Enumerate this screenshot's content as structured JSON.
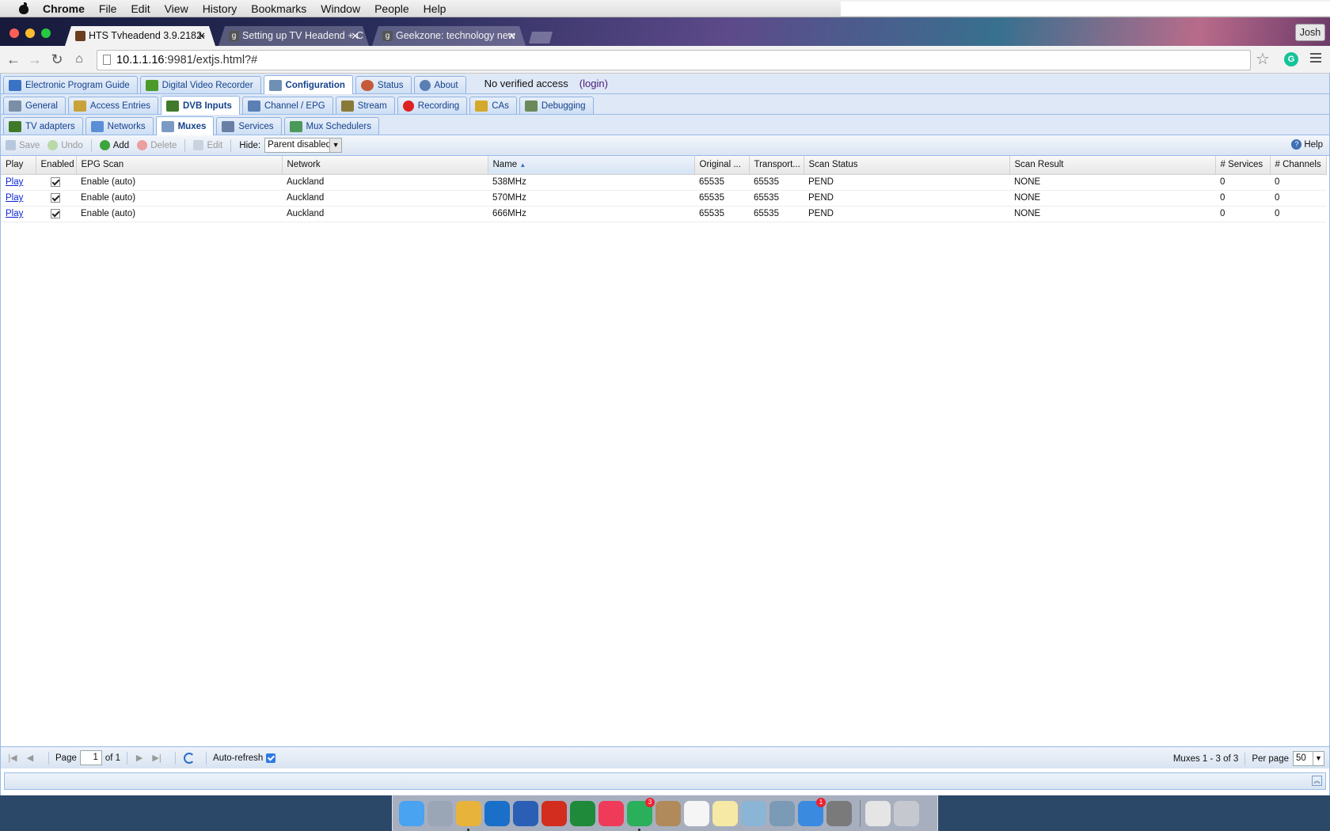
{
  "menubar": {
    "app": "Chrome",
    "items": [
      "File",
      "Edit",
      "View",
      "History",
      "Bookmarks",
      "Window",
      "People",
      "Help"
    ]
  },
  "browser": {
    "tabs": [
      {
        "title": "HTS Tvheadend 3.9.2182-",
        "active": true,
        "favicon": "tvheadend-icon"
      },
      {
        "title": "Setting up TV Headend + C",
        "active": false,
        "favicon": "g"
      },
      {
        "title": "Geekzone: technology new",
        "active": false,
        "favicon": "g"
      }
    ],
    "profile": "Josh",
    "url_host": "10.1.1.16",
    "url_rest": ":9981/extjs.html?#"
  },
  "top_tabs": [
    {
      "label": "Electronic Program Guide",
      "icon": "epg-icon",
      "color": "#3a72c4"
    },
    {
      "label": "Digital Video Recorder",
      "icon": "download-icon",
      "color": "#4c9a2a"
    },
    {
      "label": "Configuration",
      "icon": "wrench-icon",
      "color": "#6f8fb5",
      "active": true
    },
    {
      "label": "Status",
      "icon": "eye-icon",
      "color": "#c45a3a"
    },
    {
      "label": "About",
      "icon": "info-icon",
      "color": "#5a7fb5"
    }
  ],
  "access": {
    "text": "No verified access",
    "login": "(login)"
  },
  "config_tabs": [
    {
      "label": "General",
      "icon": "tools-icon",
      "color": "#7a8fa5"
    },
    {
      "label": "Access Entries",
      "icon": "users-icon",
      "color": "#c9a23a"
    },
    {
      "label": "DVB Inputs",
      "icon": "card-icon",
      "color": "#3f7a2a",
      "active": true
    },
    {
      "label": "Channel / EPG",
      "icon": "tv-icon",
      "color": "#5a7fb5"
    },
    {
      "label": "Stream",
      "icon": "stream-icon",
      "color": "#8a7a3a"
    },
    {
      "label": "Recording",
      "icon": "rec-icon",
      "color": "#d22"
    },
    {
      "label": "CAs",
      "icon": "key-icon",
      "color": "#d4a82a"
    },
    {
      "label": "Debugging",
      "icon": "bug-icon",
      "color": "#6a8a5a"
    }
  ],
  "dvb_tabs": [
    {
      "label": "TV adapters",
      "icon": "adapter-icon",
      "color": "#3f7a2a"
    },
    {
      "label": "Networks",
      "icon": "antenna-icon",
      "color": "#5a8fd5"
    },
    {
      "label": "Muxes",
      "icon": "mux-icon",
      "color": "#7a9ac5",
      "active": true
    },
    {
      "label": "Services",
      "icon": "services-icon",
      "color": "#6a7fa5"
    },
    {
      "label": "Mux Schedulers",
      "icon": "scheduler-icon",
      "color": "#4a9a5a"
    }
  ],
  "toolbar": {
    "save": "Save",
    "undo": "Undo",
    "add": "Add",
    "delete": "Delete",
    "edit": "Edit",
    "hide_label": "Hide:",
    "hide_value": "Parent disabled",
    "help": "Help"
  },
  "grid": {
    "columns": [
      "Play",
      "Enabled",
      "EPG Scan",
      "Network",
      "Name",
      "Original ...",
      "Transport...",
      "Scan Status",
      "Scan Result",
      "# Services",
      "# Channels"
    ],
    "sort_column": "Name",
    "rows": [
      {
        "play": "Play",
        "enabled": true,
        "epg": "Enable (auto)",
        "network": "Auckland",
        "name": "538MHz",
        "onid": "65535",
        "tsid": "65535",
        "scan_status": "PEND",
        "scan_result": "NONE",
        "services": "0",
        "channels": "0"
      },
      {
        "play": "Play",
        "enabled": true,
        "epg": "Enable (auto)",
        "network": "Auckland",
        "name": "570MHz",
        "onid": "65535",
        "tsid": "65535",
        "scan_status": "PEND",
        "scan_result": "NONE",
        "services": "0",
        "channels": "0"
      },
      {
        "play": "Play",
        "enabled": true,
        "epg": "Enable (auto)",
        "network": "Auckland",
        "name": "666MHz",
        "onid": "65535",
        "tsid": "65535",
        "scan_status": "PEND",
        "scan_result": "NONE",
        "services": "0",
        "channels": "0"
      }
    ]
  },
  "pager": {
    "page_label": "Page",
    "page": "1",
    "of": "of 1",
    "autorefresh": "Auto-refresh",
    "summary": "Muxes 1 - 3 of 3",
    "per_page_label": "Per page",
    "per_page": "50"
  },
  "dock": [
    {
      "name": "finder-icon",
      "color": "#4aa3f0"
    },
    {
      "name": "launchpad-icon",
      "color": "#9aa5b5"
    },
    {
      "name": "chrome-icon",
      "color": "#e8b33a",
      "running": true
    },
    {
      "name": "outlook-icon",
      "color": "#1a6fc9"
    },
    {
      "name": "word-icon",
      "color": "#2a5fb5"
    },
    {
      "name": "acrobat-icon",
      "color": "#d22d1f"
    },
    {
      "name": "excel-icon",
      "color": "#1f8a3a"
    },
    {
      "name": "itunes-icon",
      "color": "#f03a5a"
    },
    {
      "name": "spotify-icon",
      "color": "#2ab05a",
      "badge": "3",
      "running": true
    },
    {
      "name": "contacts-icon",
      "color": "#b08a5a"
    },
    {
      "name": "calendar-icon",
      "color": "#f5f5f5"
    },
    {
      "name": "notes-icon",
      "color": "#f5e9a5"
    },
    {
      "name": "preview-icon",
      "color": "#8ab5d5"
    },
    {
      "name": "photos-icon",
      "color": "#7a9ab5"
    },
    {
      "name": "appstore-icon",
      "color": "#3a8ae0",
      "badge": "1"
    },
    {
      "name": "system-preferences-icon",
      "color": "#7a7a7a"
    },
    {
      "name": "archive-icon",
      "color": "#e5e5e5"
    },
    {
      "name": "trash-icon",
      "color": "#c5c9cf"
    }
  ]
}
